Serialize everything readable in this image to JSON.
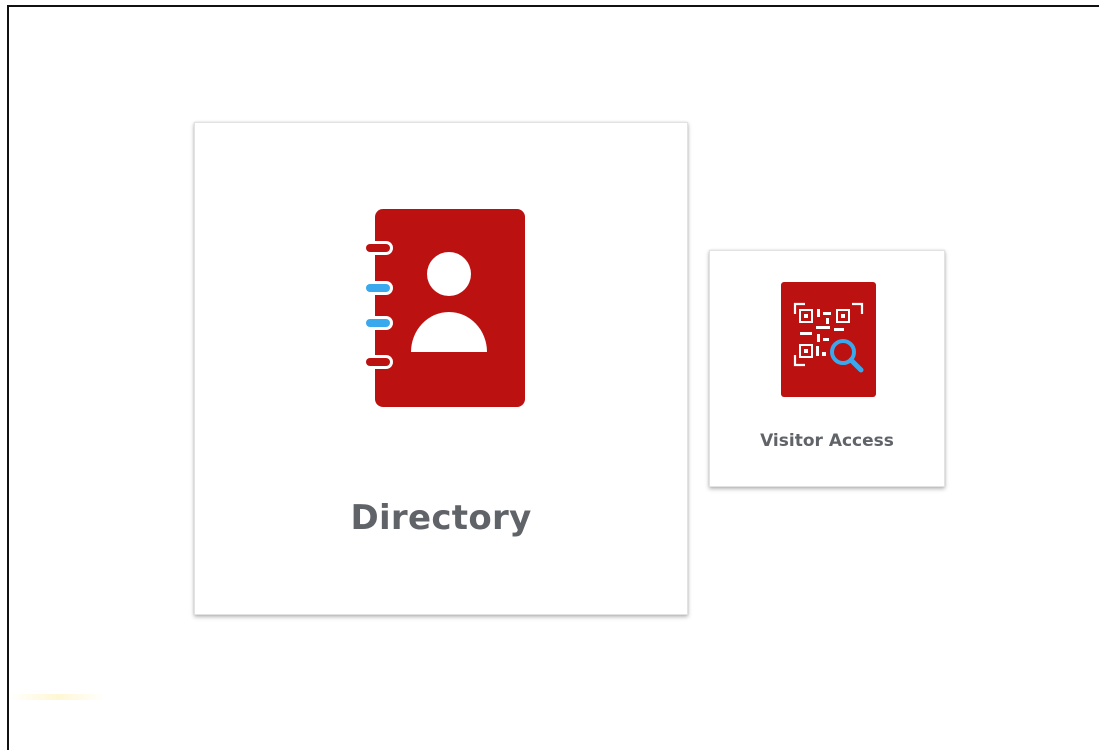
{
  "tiles": {
    "directory": {
      "label": "Directory",
      "icon": "contact-book-icon"
    },
    "visitor_access": {
      "label": "Visitor Access",
      "icon": "qr-search-icon"
    }
  },
  "colors": {
    "icon_red": "#bb1111",
    "ring_blue": "#3aa8ec",
    "label_gray": "#606368"
  }
}
